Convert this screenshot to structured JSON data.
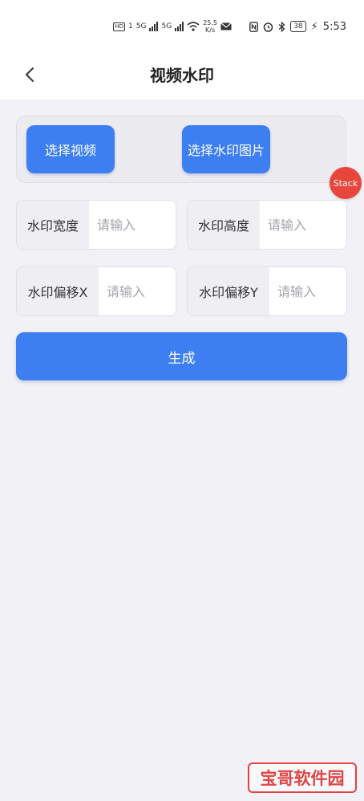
{
  "status_bar": {
    "hd_badge": "HD",
    "sim1": "1",
    "net1": "5G",
    "net2": "5G",
    "speed_value": "25.5",
    "speed_unit": "K/s",
    "battery": "38",
    "time": "5:53"
  },
  "nav": {
    "title": "视频水印"
  },
  "select": {
    "video_button": "选择视频",
    "watermark_image_button": "选择水印图片"
  },
  "floating_badge": "Stack",
  "fields": {
    "width": {
      "label": "水印宽度",
      "placeholder": "请输入"
    },
    "height": {
      "label": "水印高度",
      "placeholder": "请输入"
    },
    "offset_x": {
      "label": "水印偏移X",
      "placeholder": "请输入"
    },
    "offset_y": {
      "label": "水印偏移Y",
      "placeholder": "请输入"
    }
  },
  "generate_button": "生成",
  "watermark_logo": "宝哥软件园",
  "colors": {
    "primary": "#3d7ff0",
    "background": "#f2f1f5",
    "badge_red": "#e8453c"
  }
}
